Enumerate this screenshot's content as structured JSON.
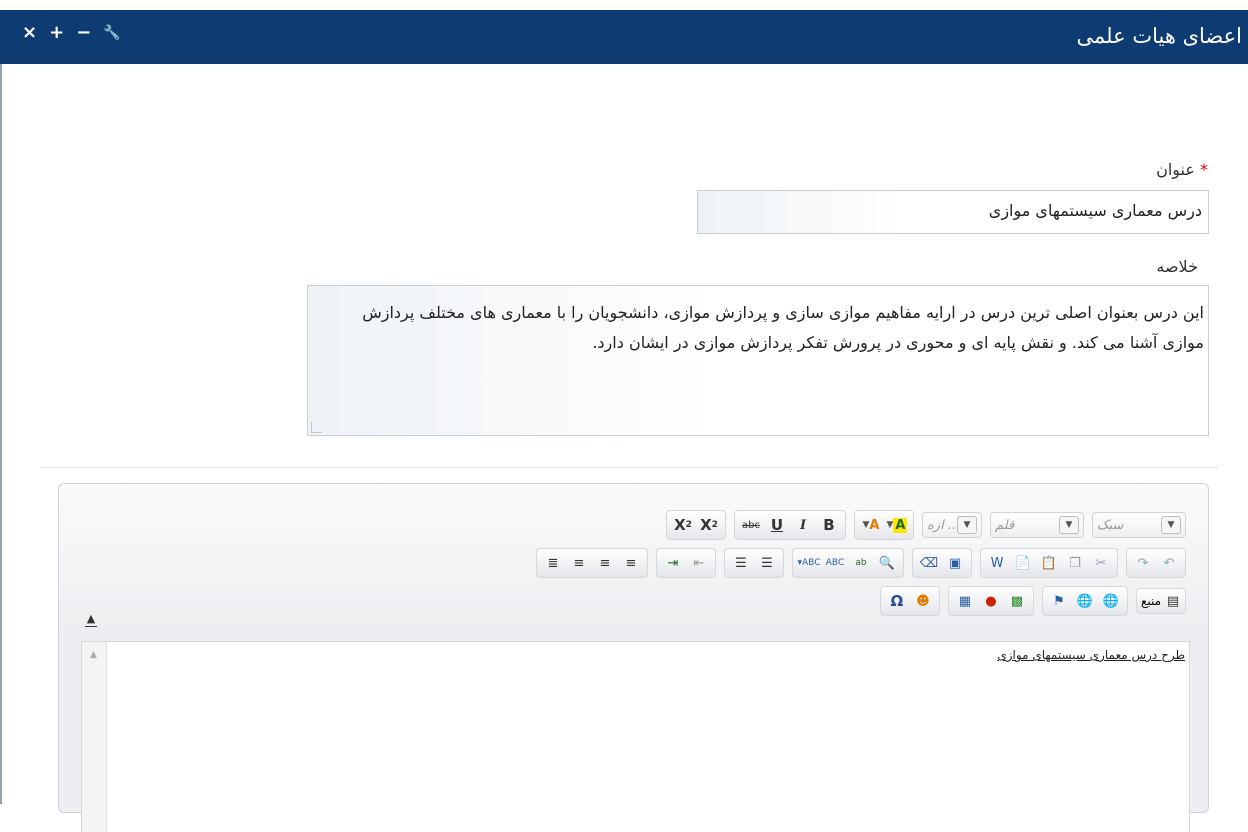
{
  "header": {
    "title": "اعضای هیات علمی",
    "controls": [
      "×",
      "+",
      "−",
      "🔧"
    ]
  },
  "form": {
    "title_label": "عنوان",
    "required_mark": "*",
    "title_value": "درس معماری سیستمهای موازی",
    "summary_label": "خلاصه",
    "summary_value": "این درس بعنوان اصلی  ترین درس در ارایه مفاهیم موازی سازی و پردازش موازی، دانشجویان را با معماری های مختلف پردازش موازی آشنا می کند. و نقش پایه ای و محوری در پرورش تفکر پردازش موازی در ایشان دارد."
  },
  "editor": {
    "style_combo": "سبک",
    "font_combo": "قلم",
    "size_combo": ".. ازه",
    "source_label": "منبع",
    "content_text": "طرح درس معماری سیستمهای موازی"
  }
}
